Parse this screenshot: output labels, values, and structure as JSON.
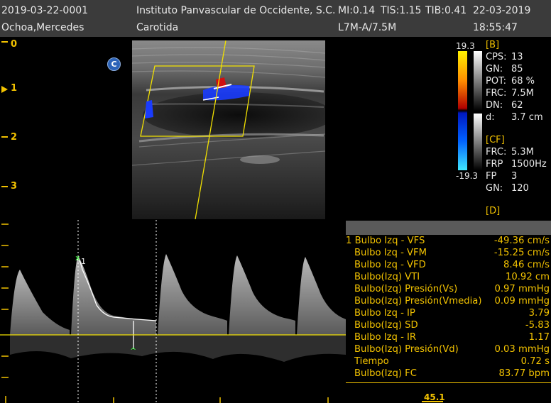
{
  "header": {
    "study_id": "2019-03-22-0001",
    "institution": "Instituto Panvascular de Occidente, S.C.",
    "mi": "MI:0.14",
    "tis": "TIS:1.15",
    "tib": "TIB:0.41",
    "date": "22-03-2019",
    "patient": "Ochoa,Mercedes",
    "exam": "Carotida",
    "probe": "L7M-A/7.5M",
    "time": "18:55:47"
  },
  "depth_scale": [
    "0",
    "1",
    "2",
    "3"
  ],
  "mode_badge": "C",
  "color_scale": {
    "top": "19.3",
    "bottom": "-19.3"
  },
  "params": {
    "b_header": "[B]",
    "b": [
      {
        "k": "CPS:",
        "v": "13"
      },
      {
        "k": "GN:",
        "v": "85"
      },
      {
        "k": "POT:",
        "v": "68 %"
      },
      {
        "k": "FRC:",
        "v": "7.5M"
      },
      {
        "k": "DN:",
        "v": "62"
      },
      {
        "k": "d:",
        "v": "3.7 cm"
      }
    ],
    "cf_header": "[CF]",
    "cf": [
      {
        "k": "FRC:",
        "v": "5.3M"
      },
      {
        "k": "FRP",
        "v": "1500Hz"
      },
      {
        "k": "FP",
        "v": "3"
      },
      {
        "k": "GN:",
        "v": "120"
      }
    ],
    "d_header": "[D]"
  },
  "cursor_label": "1",
  "measurements": [
    {
      "label": "1 Bulbo Izq - VFS",
      "value": "-49.36 cm/s"
    },
    {
      "label": "Bulbo Izq - VFM",
      "value": "-15.25 cm/s"
    },
    {
      "label": "Bulbo Izq - VFD",
      "value": "8.46 cm/s"
    },
    {
      "label": "Bulbo(Izq) VTI",
      "value": "10.92 cm"
    },
    {
      "label": "Bulbo(Izq) Presión(Vs)",
      "value": "0.97 mmHg"
    },
    {
      "label": "Bulbo(Izq) Presión(Vmedia)",
      "value": "0.09 mmHg"
    },
    {
      "label": "Bulbo Izq - IP",
      "value": "3.79"
    },
    {
      "label": "Bulbo(Izq) SD",
      "value": "-5.83"
    },
    {
      "label": "Bulbo Izq - IR",
      "value": "1.17"
    },
    {
      "label": "Bulbo(Izq) Presión(Vd)",
      "value": "0.03 mmHg"
    },
    {
      "label": "Tiempo",
      "value": "0.72 s"
    },
    {
      "label": "Bulbo(Izq) FC",
      "value": "83.77 bpm"
    }
  ],
  "bottom_readout": "45.1",
  "colors": {
    "accent": "#f2c200",
    "header_bg": "#3b3b3b",
    "doppler_blue": "#1a3cff",
    "doppler_red": "#d01010"
  }
}
